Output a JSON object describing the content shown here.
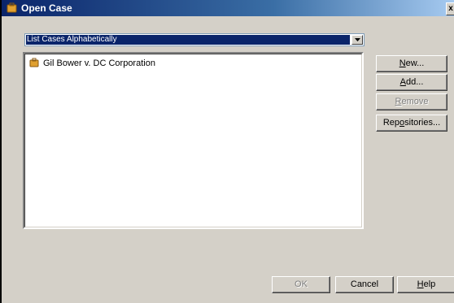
{
  "window": {
    "title": "Open Case",
    "close_label": "x"
  },
  "sort_combo": {
    "selected": "List Cases Alphabetically"
  },
  "cases": [
    {
      "label": "Gil Bower v. DC Corporation",
      "icon": "case-folder-icon"
    }
  ],
  "side_buttons": {
    "new_pre": "",
    "new_ul": "N",
    "new_post": "ew...",
    "add_pre": "",
    "add_ul": "A",
    "add_post": "dd...",
    "remove_pre": "",
    "remove_ul": "R",
    "remove_post": "emove",
    "repos_pre": "Rep",
    "repos_ul": "o",
    "repos_post": "sitories..."
  },
  "bottom_buttons": {
    "ok": "OK",
    "cancel": "Cancel",
    "help_ul": "H",
    "help_post": "elp"
  },
  "colors": {
    "selection": "#0a246a",
    "dialog_bg": "#d4d0c8"
  }
}
